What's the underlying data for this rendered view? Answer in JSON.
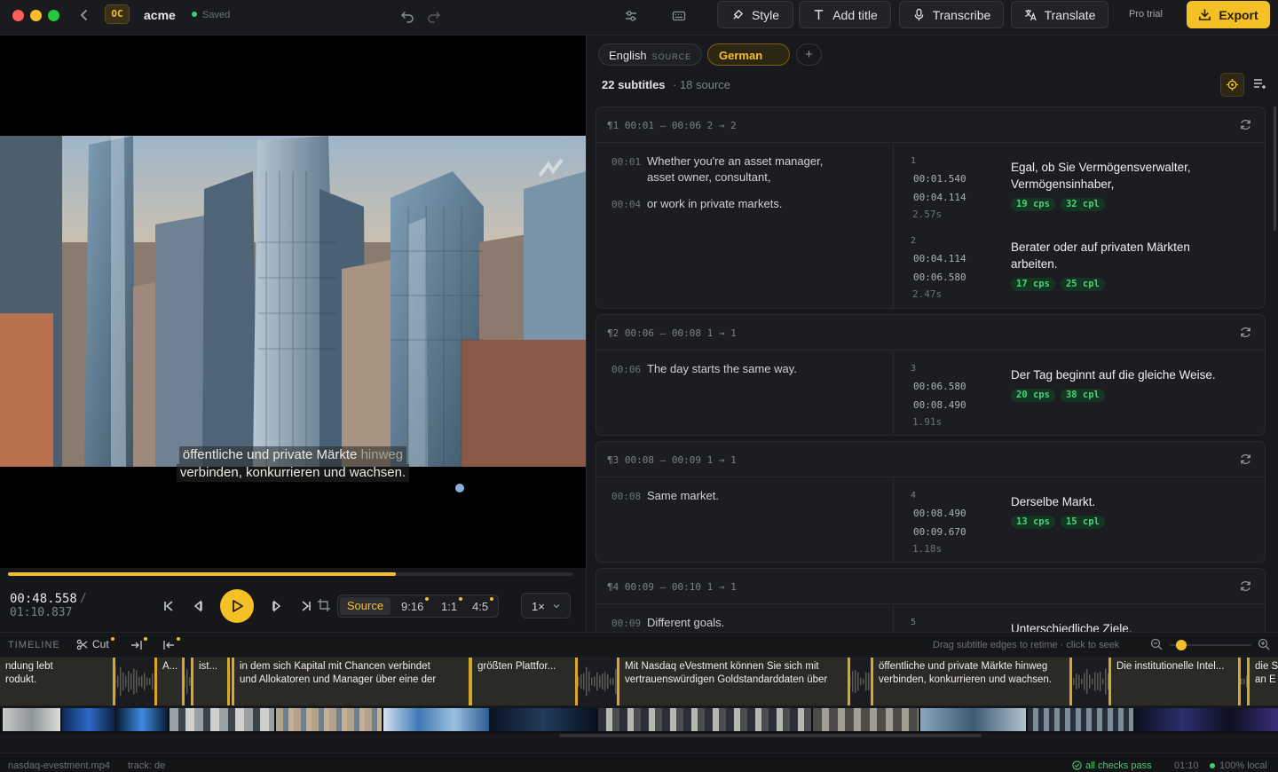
{
  "app": {
    "logo": "OC",
    "project": "acme",
    "saved_status": "Saved"
  },
  "toolbar": {
    "style": "Style",
    "add_title": "Add title",
    "transcribe": "Transcribe",
    "translate": "Translate",
    "pro_trial": "Pro trial",
    "export": "Export"
  },
  "player": {
    "caption_line1_main": "öffentliche und private Märkte",
    "caption_line1_dim": "hinweg",
    "caption_line2": "verbinden, konkurrieren und wachsen.",
    "time_current": "00:48.558",
    "time_separator": "/",
    "time_total": "01:10.837",
    "progress_fraction": 0.686,
    "aspects": {
      "source": "Source",
      "a916": "9:16",
      "a11": "1:1",
      "a45": "4:5"
    },
    "speed": "1×"
  },
  "timeline": {
    "label": "TIMELINE",
    "cut": "Cut",
    "hint": "Drag subtitle edges to retime · click to seek",
    "zoom_level": 0.14,
    "segments": [
      {
        "l1": "ndung lebt",
        "l2": "rodukt."
      },
      {
        "l1": "A...",
        "l2": ""
      },
      {
        "l1": "ist...",
        "l2": ""
      },
      {
        "l1": "in dem sich Kapital mit Chancen verbindet",
        "l2": "und Allokatoren und Manager über eine der"
      },
      {
        "l1": "größten Plattfor...",
        "l2": ""
      },
      {
        "l1": "Mit Nasdaq eVestment können Sie sich mit",
        "l2": "vertrauenswürdigen Goldstandarddaten über"
      },
      {
        "l1": "öffentliche und private Märkte hinweg",
        "l2": "verbinden, konkurrieren und wachsen."
      },
      {
        "l1": "Die institutionelle Intel...",
        "l2": ""
      },
      {
        "l1": "die S",
        "l2": "an E"
      }
    ]
  },
  "status": {
    "file": "nasdaq-evestment.mp4",
    "track": "track: de",
    "checks": "all checks pass",
    "duration": "01:10",
    "local": "100% local"
  },
  "panel": {
    "lang_source": "English",
    "lang_source_tag": "SOURCE",
    "lang_target": "German",
    "lang_add": "+",
    "count": "22 subtitles",
    "source_count": "· 18 source",
    "cards": [
      {
        "meta": "¶1  00:01 – 00:06  2 → 2",
        "src": [
          {
            "ts": "00:01",
            "text": "Whether you're an asset manager, asset owner, consultant,"
          },
          {
            "ts": "00:04",
            "text": "or work in private markets."
          }
        ],
        "tgt": [
          {
            "num": "1",
            "start": "00:01.540",
            "end": "00:04.114",
            "dur": "2.57s",
            "text": "Egal, ob Sie Vermögensverwalter, Vermögensinhaber,",
            "cps": "19 cps",
            "cpl": "32 cpl"
          },
          {
            "num": "2",
            "start": "00:04.114",
            "end": "00:06.580",
            "dur": "2.47s",
            "text": "Berater oder auf privaten Märkten arbeiten.",
            "cps": "17 cps",
            "cpl": "25 cpl"
          }
        ]
      },
      {
        "meta": "¶2  00:06 – 00:08  1 → 1",
        "src": [
          {
            "ts": "00:06",
            "text": "The day starts the same way."
          }
        ],
        "tgt": [
          {
            "num": "3",
            "start": "00:06.580",
            "end": "00:08.490",
            "dur": "1.91s",
            "text": "Der Tag beginnt auf die gleiche Weise.",
            "cps": "20 cps",
            "cpl": "38 cpl"
          }
        ]
      },
      {
        "meta": "¶3  00:08 – 00:09  1 → 1",
        "src": [
          {
            "ts": "00:08",
            "text": "Same market."
          }
        ],
        "tgt": [
          {
            "num": "4",
            "start": "00:08.490",
            "end": "00:09.670",
            "dur": "1.18s",
            "text": "Derselbe Markt.",
            "cps": "13 cps",
            "cpl": "15 cpl"
          }
        ]
      },
      {
        "meta": "¶4  00:09 – 00:10  1 → 1",
        "src": [
          {
            "ts": "00:09",
            "text": "Different goals."
          }
        ],
        "tgt": [
          {
            "num": "5",
            "start": "",
            "end": "",
            "dur": "",
            "text": "Unterschiedliche Ziele.",
            "cps": "",
            "cpl": ""
          }
        ]
      }
    ]
  },
  "colors": {
    "accent": "#f5c026",
    "ok": "#3ecf6a",
    "bg": "#16171a"
  }
}
